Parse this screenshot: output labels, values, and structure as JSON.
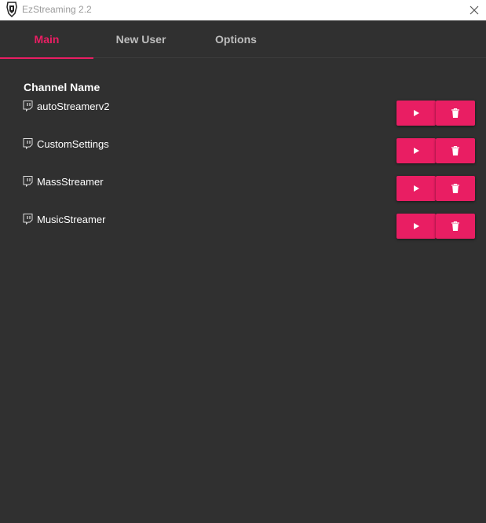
{
  "window": {
    "title": "EzStreaming 2.2"
  },
  "tabs": [
    {
      "label": "Main",
      "active": true
    },
    {
      "label": "New User",
      "active": false
    },
    {
      "label": "Options",
      "active": false
    }
  ],
  "list": {
    "header": "Channel Name",
    "rows": [
      {
        "name": "autoStreamerv2",
        "icon": "twitch-icon"
      },
      {
        "name": "CustomSettings",
        "icon": "twitch-icon"
      },
      {
        "name": "MassStreamer",
        "icon": "twitch-icon"
      },
      {
        "name": "MusicStreamer",
        "icon": "twitch-icon"
      }
    ],
    "actions": {
      "play_icon": "play-icon",
      "delete_icon": "trash-icon"
    }
  },
  "colors": {
    "accent": "#e91e63",
    "background": "#303030",
    "text": "#ffffff",
    "tab_inactive": "#bdbdbd"
  }
}
